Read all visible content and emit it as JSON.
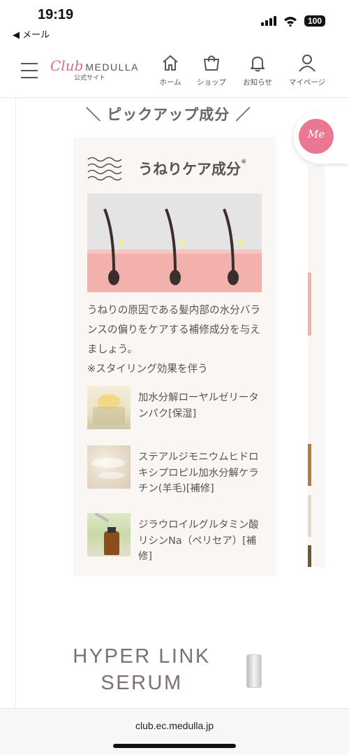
{
  "status_bar": {
    "time": "19:19",
    "back_label": "◀ メール",
    "battery": "100"
  },
  "header": {
    "logo_club": "Club",
    "logo_brand": "MEDULLA",
    "logo_sub": "公式サイト",
    "nav": [
      {
        "label": "ホーム",
        "icon": "home-icon"
      },
      {
        "label": "ショップ",
        "icon": "shopping-bag-icon"
      },
      {
        "label": "お知らせ",
        "icon": "bell-icon"
      },
      {
        "label": "マイページ",
        "icon": "user-icon"
      }
    ]
  },
  "section": {
    "pickup_title": "＼ ピックアップ成分 ／",
    "card": {
      "title": "うねりケア成分",
      "title_mark": "※",
      "description": "うねりの原因である髪内部の水分バランスの偏りをケアする補修成分を与えましょう。",
      "note": "※スタイリング効果を伴う",
      "ingredients": [
        {
          "name": "加水分解ローヤルゼリータンパク[保湿]"
        },
        {
          "name": "ステアルジモニウムヒドロキシプロピル加水分解ケラチン(羊毛)[補修]"
        },
        {
          "name": "ジラウロイルグルタミン酸リシンNa（ペリセア）[補修]"
        }
      ]
    },
    "me_badge": "Me",
    "product_title": "HYPER LINK SERUM"
  },
  "url_bar": {
    "url": "club.ec.medulla.jp"
  },
  "colors": {
    "brand_pink": "#d96b8e",
    "badge_pink": "#eb7892",
    "card_bg": "#f9f6f4"
  }
}
